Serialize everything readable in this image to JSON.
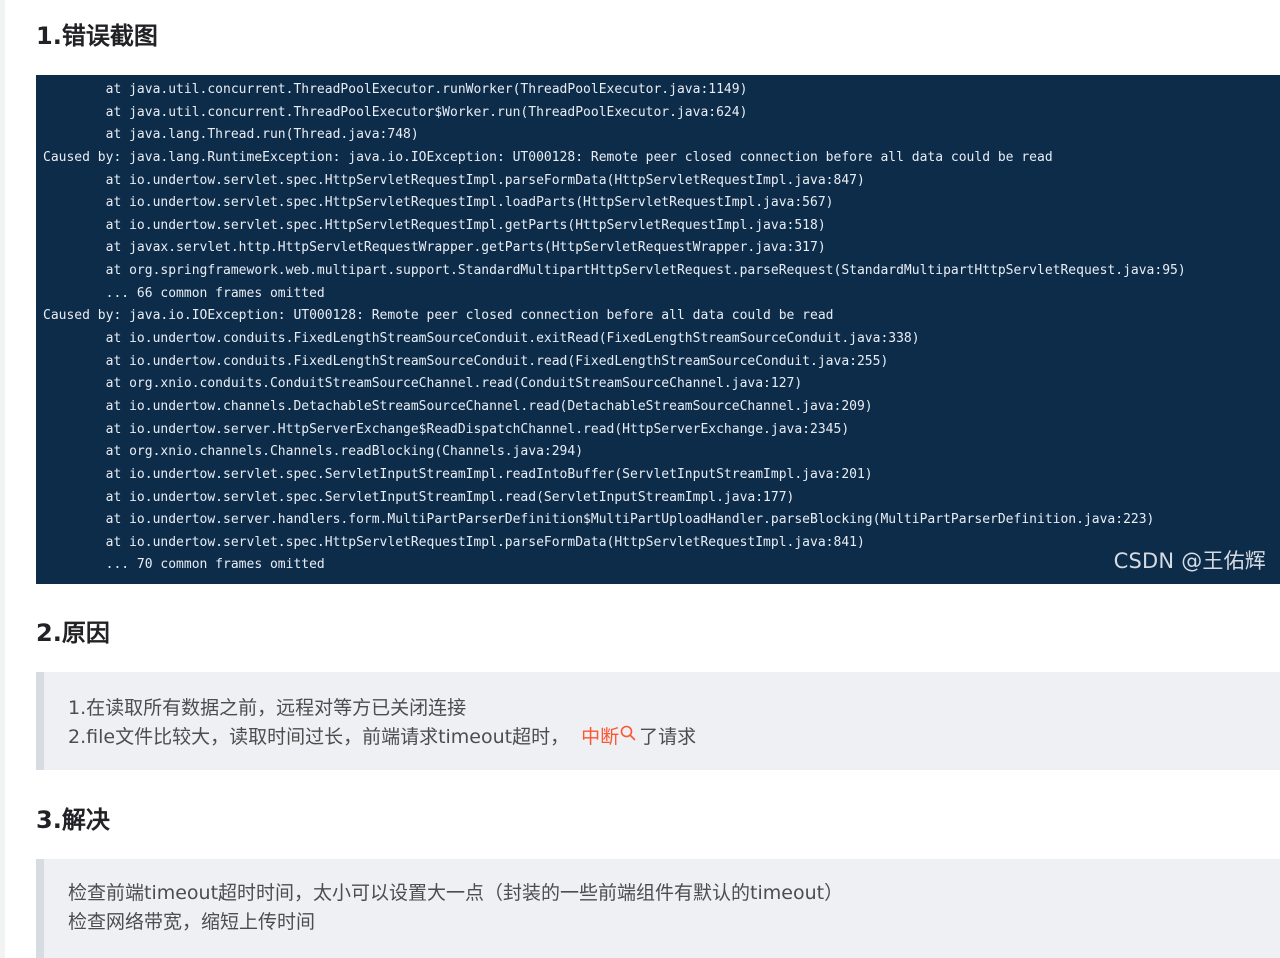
{
  "sections": {
    "error_heading": "1.错误截图",
    "cause_heading": "2.原因",
    "solution_heading": "3.解决"
  },
  "stack_trace": {
    "lines": [
      "        at java.util.concurrent.ThreadPoolExecutor.runWorker(ThreadPoolExecutor.java:1149)",
      "        at java.util.concurrent.ThreadPoolExecutor$Worker.run(ThreadPoolExecutor.java:624)",
      "        at java.lang.Thread.run(Thread.java:748)",
      "Caused by: java.lang.RuntimeException: java.io.IOException: UT000128: Remote peer closed connection before all data could be read",
      "        at io.undertow.servlet.spec.HttpServletRequestImpl.parseFormData(HttpServletRequestImpl.java:847)",
      "        at io.undertow.servlet.spec.HttpServletRequestImpl.loadParts(HttpServletRequestImpl.java:567)",
      "        at io.undertow.servlet.spec.HttpServletRequestImpl.getParts(HttpServletRequestImpl.java:518)",
      "        at javax.servlet.http.HttpServletRequestWrapper.getParts(HttpServletRequestWrapper.java:317)",
      "        at org.springframework.web.multipart.support.StandardMultipartHttpServletRequest.parseRequest(StandardMultipartHttpServletRequest.java:95)",
      "        ... 66 common frames omitted",
      "Caused by: java.io.IOException: UT000128: Remote peer closed connection before all data could be read",
      "        at io.undertow.conduits.FixedLengthStreamSourceConduit.exitRead(FixedLengthStreamSourceConduit.java:338)",
      "        at io.undertow.conduits.FixedLengthStreamSourceConduit.read(FixedLengthStreamSourceConduit.java:255)",
      "        at org.xnio.conduits.ConduitStreamSourceChannel.read(ConduitStreamSourceChannel.java:127)",
      "        at io.undertow.channels.DetachableStreamSourceChannel.read(DetachableStreamSourceChannel.java:209)",
      "        at io.undertow.server.HttpServerExchange$ReadDispatchChannel.read(HttpServerExchange.java:2345)",
      "        at org.xnio.channels.Channels.readBlocking(Channels.java:294)",
      "        at io.undertow.servlet.spec.ServletInputStreamImpl.readIntoBuffer(ServletInputStreamImpl.java:201)",
      "        at io.undertow.servlet.spec.ServletInputStreamImpl.read(ServletInputStreamImpl.java:177)",
      "        at io.undertow.server.handlers.form.MultiPartParserDefinition$MultiPartUploadHandler.parseBlocking(MultiPartParserDefinition.java:223)",
      "        at io.undertow.servlet.spec.HttpServletRequestImpl.parseFormData(HttpServletRequestImpl.java:841)",
      "        ... 70 common frames omitted"
    ],
    "watermark": "CSDN @王佑辉"
  },
  "causes": {
    "line1": "1.在读取所有数据之前，远程对等方已关闭连接",
    "line2_prefix": "2.file文件比较大，读取时间过长，前端请求timeout超时，",
    "line2_link": "中断",
    "line2_suffix": "了请求"
  },
  "solutions": {
    "line1": "检查前端timeout超时时间，太小可以设置大一点（封装的一些前端组件有默认的timeout）",
    "line2": "检查网络带宽，缩短上传时间"
  },
  "icons": {
    "search": "search-icon"
  },
  "colors": {
    "code_background": "#0d2c4a",
    "link": "#fc5531",
    "quote_background": "#eef0f4"
  }
}
